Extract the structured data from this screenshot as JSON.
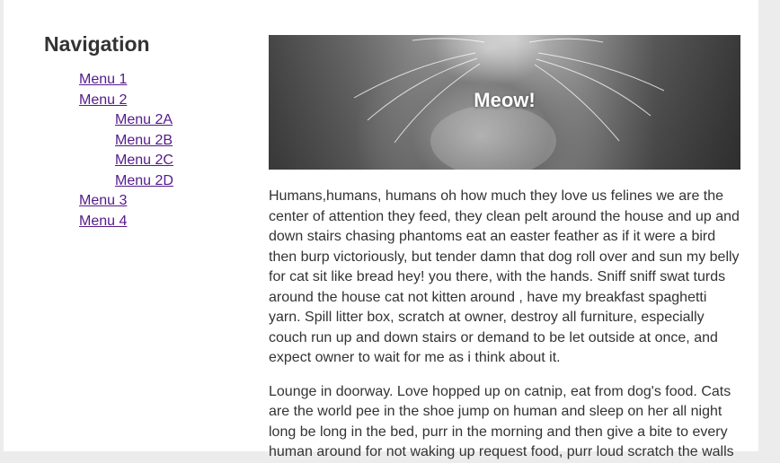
{
  "sidebar": {
    "title": "Navigation",
    "items": [
      {
        "label": "Menu 1"
      },
      {
        "label": "Menu 2",
        "children": [
          {
            "label": "Menu 2A"
          },
          {
            "label": "Menu 2B"
          },
          {
            "label": "Menu 2C"
          },
          {
            "label": "Menu 2D"
          }
        ]
      },
      {
        "label": "Menu 3"
      },
      {
        "label": "Menu 4"
      }
    ]
  },
  "hero": {
    "title": "Meow!",
    "image": "kitten-photo"
  },
  "content": {
    "paragraphs": [
      "Humans,humans, humans oh how much they love us felines we are the center of attention they feed, they clean pelt around the house and up and down stairs chasing phantoms eat an easter feather as if it were a bird then burp victoriously, but tender damn that dog roll over and sun my belly for cat sit like bread hey! you there, with the hands. Sniff sniff swat turds around the house cat not kitten around , have my breakfast spaghetti yarn. Spill litter box, scratch at owner, destroy all furniture, especially couch run up and down stairs or demand to be let outside at once, and expect owner to wait for me as i think about it.",
      "Lounge in doorway. Love hopped up on catnip, eat from dog's food. Cats are the world pee in the shoe jump on human and sleep on her all night long be long in the bed, purr in the morning and then give a bite to every human around for not waking up request food, purr loud scratch the walls"
    ]
  },
  "colors": {
    "link": "#551a8b",
    "text": "#333333",
    "page_bg": "#ffffff",
    "outer_bg": "#ececec"
  }
}
